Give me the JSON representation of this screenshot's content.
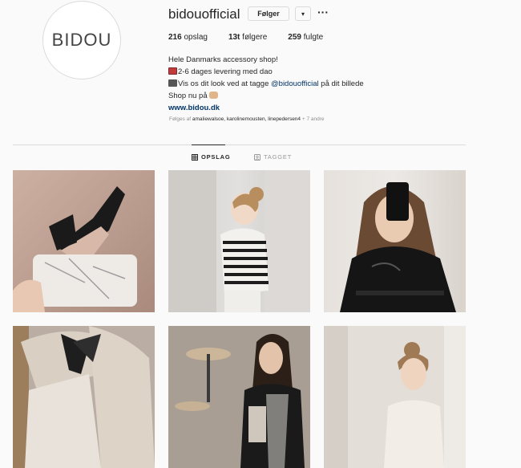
{
  "profile": {
    "avatar_text": "BIDOU",
    "username": "bidouofficial",
    "follow_label": "Følger",
    "dropdown_label": "▾",
    "more_label": "···",
    "stats": [
      {
        "count": "216",
        "label": "opslag"
      },
      {
        "count": "13t",
        "label": "følgere"
      },
      {
        "count": "259",
        "label": "fulgte"
      }
    ],
    "bio": {
      "line1": "Hele Danmarks accessory shop!",
      "line2": "2-6 dages levering med dao",
      "line3_pre": "Vis os dit look ved at tagge ",
      "line3_handle": "@bidouofficial",
      "line3_post": " på dit billede",
      "line4": "Shop nu på",
      "link": "www.bidou.dk"
    },
    "followed_by": {
      "prefix": "Følges af ",
      "names": "amaliewalsoe, karolinemousten, linepedersen4",
      "suffix": " + 7 andre"
    }
  },
  "tabs": [
    {
      "label": "OPSLAG",
      "icon": "grid-icon",
      "active": true
    },
    {
      "label": "TAGGET",
      "icon": "tag-icon",
      "active": false
    }
  ],
  "colors": {
    "link": "#003569",
    "muted": "#8e8e8e",
    "border": "#dbdbdb",
    "background": "#fafafa"
  }
}
